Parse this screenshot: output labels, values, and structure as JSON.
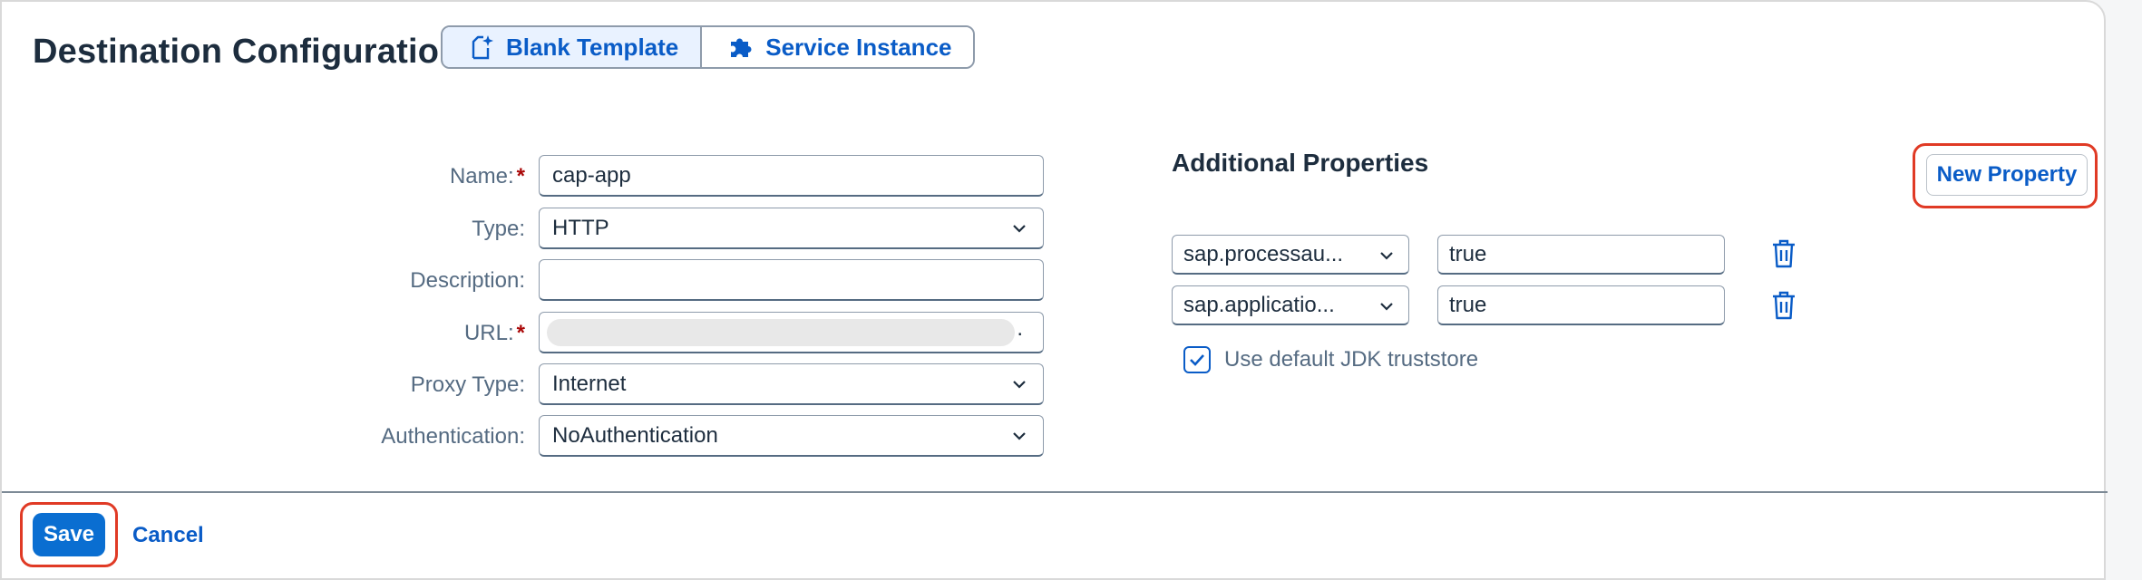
{
  "header": {
    "title": "Destination Configuration",
    "segments": [
      {
        "label": "Blank Template",
        "selected": true,
        "icon": "new-document-icon"
      },
      {
        "label": "Service Instance",
        "selected": false,
        "icon": "puzzle-icon"
      }
    ]
  },
  "form": {
    "name": {
      "label": "Name:",
      "required": true,
      "value": "cap-app"
    },
    "type": {
      "label": "Type:",
      "required": false,
      "value": "HTTP"
    },
    "description": {
      "label": "Description:",
      "required": false,
      "value": ""
    },
    "url": {
      "label": "URL:",
      "required": true,
      "value": "."
    },
    "proxy_type": {
      "label": "Proxy Type:",
      "required": false,
      "value": "Internet"
    },
    "authentication": {
      "label": "Authentication:",
      "required": false,
      "value": "NoAuthentication"
    }
  },
  "additional": {
    "title": "Additional Properties",
    "new_property_label": "New Property",
    "properties": [
      {
        "key": "sap.processau...",
        "value": "true"
      },
      {
        "key": "sap.applicatio...",
        "value": "true"
      }
    ],
    "checkbox": {
      "label": "Use default JDK truststore",
      "checked": true
    }
  },
  "footer": {
    "save_label": "Save",
    "cancel_label": "Cancel"
  },
  "colors": {
    "accent": "#0a6ed1",
    "link": "#0a5cc7",
    "highlight": "#e03a25",
    "required": "#aa0808"
  }
}
